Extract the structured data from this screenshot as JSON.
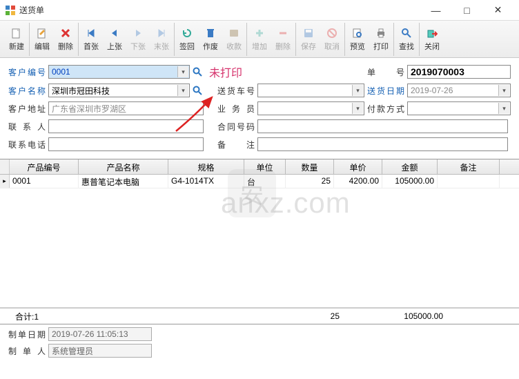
{
  "window": {
    "title": "送货单"
  },
  "win_btns": {
    "min": "—",
    "max": "□",
    "close": "✕"
  },
  "toolbar": [
    {
      "id": "new",
      "label": "新建",
      "disabled": false
    },
    {
      "id": "edit",
      "label": "编辑",
      "disabled": false
    },
    {
      "id": "delete",
      "label": "删除",
      "disabled": false
    },
    {
      "id": "first",
      "label": "首张",
      "disabled": false
    },
    {
      "id": "prev",
      "label": "上张",
      "disabled": false
    },
    {
      "id": "next",
      "label": "下张",
      "disabled": true
    },
    {
      "id": "last",
      "label": "末张",
      "disabled": true
    },
    {
      "id": "signback",
      "label": "签回",
      "disabled": false
    },
    {
      "id": "void",
      "label": "作废",
      "disabled": false
    },
    {
      "id": "receive",
      "label": "收款",
      "disabled": true
    },
    {
      "id": "add",
      "label": "增加",
      "disabled": true
    },
    {
      "id": "remove",
      "label": "删除",
      "disabled": true
    },
    {
      "id": "save",
      "label": "保存",
      "disabled": true
    },
    {
      "id": "cancel",
      "label": "取消",
      "disabled": true
    },
    {
      "id": "preview",
      "label": "预览",
      "disabled": false
    },
    {
      "id": "print",
      "label": "打印",
      "disabled": false
    },
    {
      "id": "search",
      "label": "查找",
      "disabled": false
    },
    {
      "id": "close",
      "label": "关闭",
      "disabled": false
    }
  ],
  "form": {
    "labels": {
      "custNo": "客户编号",
      "custName": "客户名称",
      "custAddr": "客户地址",
      "contact": "联 系 人",
      "phone": "联系电话",
      "status": "未打印",
      "carNo": "送货车号",
      "salesman": "业 务 员",
      "contractNo": "合同号码",
      "remark": "备　　注",
      "orderNo": "单　　号",
      "deliverDate": "送货日期",
      "payMethod": "付款方式"
    },
    "values": {
      "custNo": "0001",
      "custName": "深圳市冠田科技",
      "custAddr": "广东省深圳市罗湖区",
      "contact": "",
      "phone": "",
      "carNo": "",
      "salesman": "",
      "contractNo": "",
      "remark": "",
      "orderNo": "2019070003",
      "deliverDate": "2019-07-26",
      "payMethod": ""
    }
  },
  "grid": {
    "headers": [
      "产品编号",
      "产品名称",
      "规格",
      "单位",
      "数量",
      "单价",
      "金额",
      "备注"
    ],
    "rows": [
      {
        "code": "0001",
        "name": "惠普笔记本电脑",
        "spec": "G4-1014TX",
        "unit": "台",
        "qty": "25",
        "price": "4200.00",
        "amount": "105000.00",
        "remark": ""
      }
    ]
  },
  "summary": {
    "label": "合计:",
    "count": "1",
    "qty": "25",
    "amount": "105000.00"
  },
  "footer": {
    "labels": {
      "makeDate": "制单日期",
      "maker": "制 单 人"
    },
    "values": {
      "makeDate": "2019-07-26 11:05:13",
      "maker": "系统管理员"
    }
  }
}
